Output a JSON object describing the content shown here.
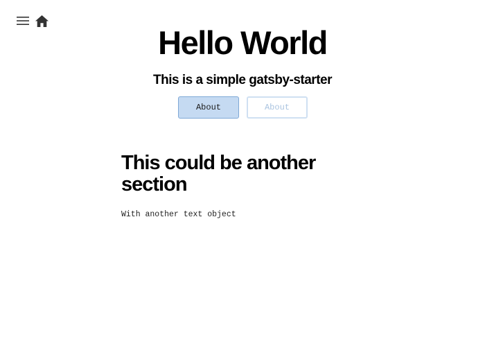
{
  "nav": {
    "menu_icon": "hamburger-menu-icon",
    "home_icon": "home-icon"
  },
  "hero": {
    "title": "Hello World",
    "subtitle": "This is a simple gatsby-starter",
    "buttons": [
      {
        "label": "About",
        "style": "filled"
      },
      {
        "label": "About",
        "style": "outline"
      }
    ]
  },
  "section": {
    "title": "This could be another section",
    "text": "With another text object"
  },
  "colors": {
    "primary_fill": "#c5daf2",
    "primary_border": "#7ea8d6",
    "outline_border": "#cfe0f2",
    "outline_text": "#aac4e0",
    "icon": "#333333"
  }
}
